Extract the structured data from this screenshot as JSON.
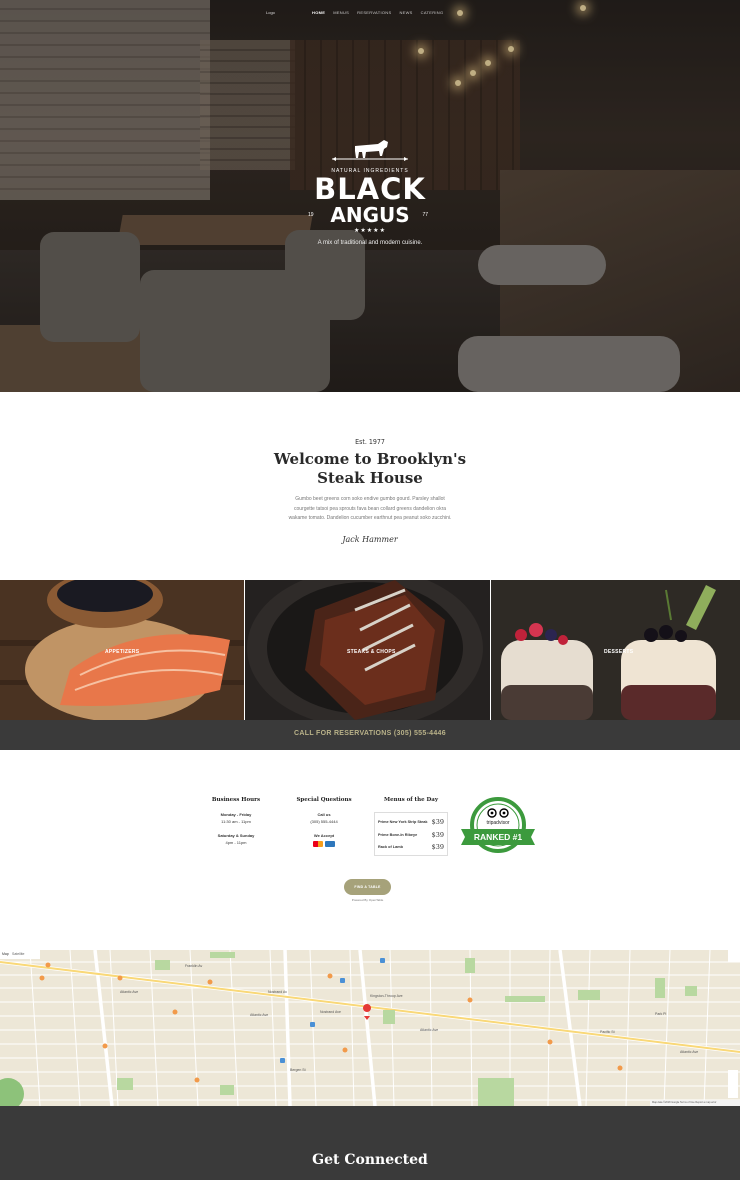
{
  "nav": {
    "logo": "Logo",
    "items": [
      "HOME",
      "MENUS",
      "RESERVATIONS",
      "NEWS",
      "CATERING"
    ],
    "active_index": 0
  },
  "hero": {
    "natural": "NATURAL INGREDIENTS",
    "brand_line1": "BLACK",
    "brand_line2": "ANGUS",
    "year_left": "19",
    "year_right": "77",
    "stars": "★★★★★",
    "tagline": "A mix of traditional and modern cuisine."
  },
  "welcome": {
    "est": "Est. 1977",
    "title_line1": "Welcome to Brooklyn's",
    "title_line2": "Steak House",
    "body": "Gumbo beet greens corn soko endive gumbo gourd. Parsley shallot courgette tatsoi pea sprouts fava bean collard greens dandelion okra wakame tomato. Dandelion cucumber earthnut pea peanut soko zucchini.",
    "signature": "Jack Hammer"
  },
  "categories": [
    {
      "label": "APPETIZERS"
    },
    {
      "label": "STEAKS & CHOPS"
    },
    {
      "label": "DESSERTS"
    }
  ],
  "reservation": {
    "text": "CALL FOR RESERVATIONS (305) 555-4446"
  },
  "info": {
    "hours": {
      "title": "Business Hours",
      "l1_label": "Monday - Friday",
      "l1_value": "11:30 am - 11pm",
      "l2_label": "Saturday & Sunday",
      "l2_value": "4pm - 11pm"
    },
    "questions": {
      "title": "Special Questions",
      "call_label": "Call us",
      "phone": "(305) 555-4444",
      "accept_label": "We Accept"
    },
    "menus": {
      "title": "Menus of the Day",
      "items": [
        {
          "name": "Prime New York Strip Steak",
          "price": "$39"
        },
        {
          "name": "Prime Bone-In Ribeye",
          "price": "$39"
        },
        {
          "name": "Rack of Lamb",
          "price": "$39"
        }
      ]
    },
    "tripadvisor": {
      "brand": "tripadvisor",
      "ranked": "RANKED #1"
    },
    "find_table": "FIND A TABLE",
    "powered": "Powered By OpenTable"
  },
  "map": {
    "type_map": "Map",
    "type_sat": "Satellite",
    "labels": [
      "Atlantic Ave",
      "Atlantic Ave",
      "Atlantic Ave",
      "Franklin Av",
      "Nostrand Av",
      "Kingston-Throop Ave",
      "Atlantic Ave",
      "Bergen St",
      "Park Pl",
      "Nostrand Ave",
      "Pacific St"
    ],
    "footer": "Map data ©2018 Google   Terms of Use   Report a map error"
  },
  "footer": {
    "title": "Get Connected"
  },
  "colors": {
    "accent": "#a6a27a",
    "reserve_text": "#b9b289",
    "dark": "#3a3a3a",
    "trip_green": "#3c9a3d"
  }
}
